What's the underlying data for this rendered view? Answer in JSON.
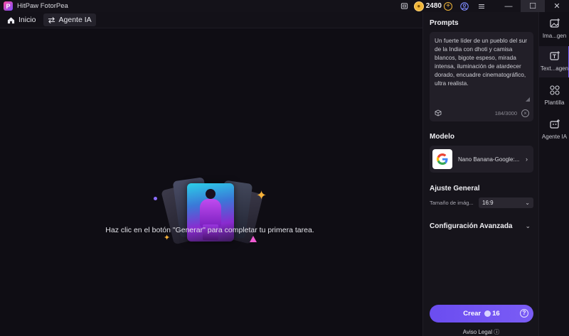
{
  "app": {
    "title": "HitPaw FotorPea",
    "logo_letter": "P"
  },
  "titlebar": {
    "credits": "2480",
    "icons": [
      "box-icon",
      "coin-icon",
      "plus-icon",
      "user-icon",
      "menu-icon"
    ]
  },
  "window": {
    "minimize": "—",
    "maximize": "☐",
    "close": "✕"
  },
  "toolbar": {
    "home_label": "Inicio",
    "agent_label": "Agente IA"
  },
  "canvas": {
    "empty_message": "Haz clic en el botón \"Generar\" para completar tu primera tarea."
  },
  "panel": {
    "prompts_title": "Prompts",
    "prompt_text": "Un fuerte líder de un pueblo del sur de la India con dhoti y camisa blancos, bigote espeso, mirada intensa, iluminación de atardecer dorado, encuadre cinematográfico, ultra realista.",
    "prompt_counter": "184/3000",
    "model_title": "Modelo",
    "model_name": "Nano Banana-Google:...",
    "general_title": "Ajuste General",
    "size_label": "Tamaño de imág...",
    "size_value": "16:9",
    "advanced_title": "Configuración Avanzada",
    "create_label": "Crear",
    "create_cost": "16",
    "legal": "Aviso Legal"
  },
  "rail": [
    {
      "label": "Ima...gen",
      "icon": "image-icon"
    },
    {
      "label": "Text...agen",
      "icon": "text-to-image-icon"
    },
    {
      "label": "Plantilla",
      "icon": "template-icon"
    },
    {
      "label": "Agente IA",
      "icon": "agent-icon"
    }
  ],
  "colors": {
    "accent": "#7b5cff",
    "coin": "#f0b63a",
    "bg": "#0f0d14"
  }
}
